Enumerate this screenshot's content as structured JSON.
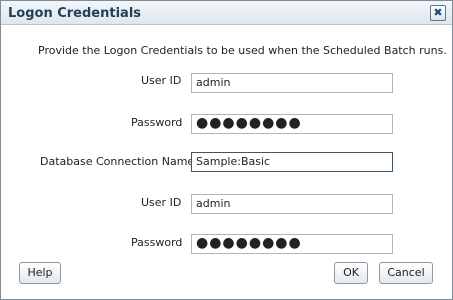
{
  "dialog": {
    "title": "Logon Credentials",
    "close_icon_glyph": "✖",
    "intro_text": "Provide the Logon Credentials to be used when the Scheduled Batch runs."
  },
  "form": {
    "user_id_label_1": "User ID",
    "user_id_value_1": "admin",
    "password_label_1": "Password",
    "password_value_1": "●●●●●●●●",
    "db_connection_label": "Database Connection Name:",
    "db_connection_value": "Sample:Basic",
    "user_id_label_2": "User ID",
    "user_id_value_2": "admin",
    "password_label_2": "Password",
    "password_value_2": "●●●●●●●●"
  },
  "buttons": {
    "help": "Help",
    "ok": "OK",
    "cancel": "Cancel"
  }
}
